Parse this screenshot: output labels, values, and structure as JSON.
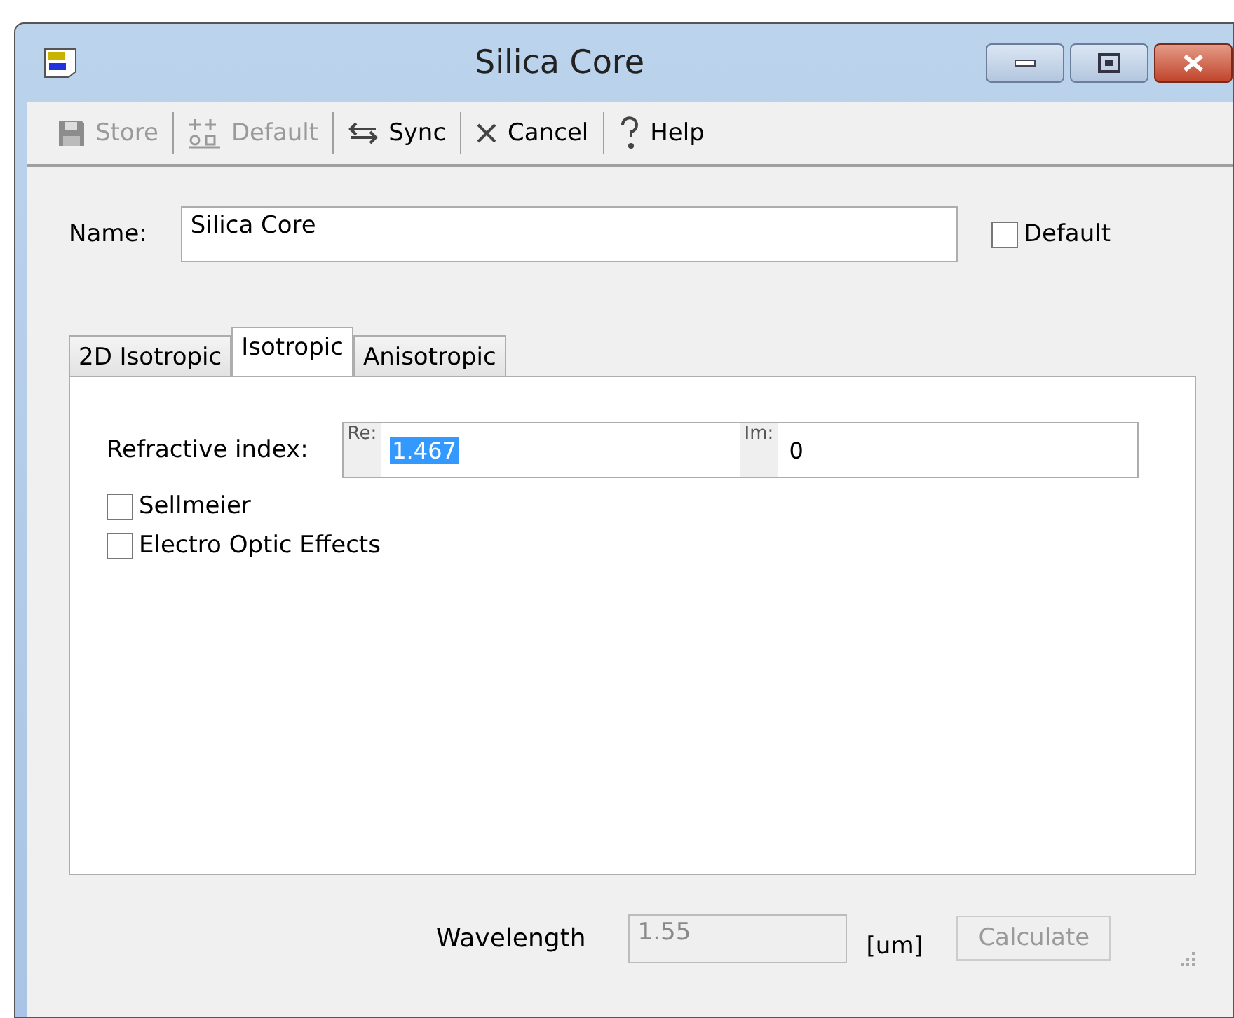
{
  "window": {
    "title": "Silica Core"
  },
  "toolbar": [
    {
      "kind": "store",
      "label": "Store",
      "disabled": true
    },
    {
      "kind": "default",
      "label": "Default",
      "disabled": true
    },
    {
      "kind": "sync",
      "label": "Sync",
      "disabled": false
    },
    {
      "kind": "cancel",
      "label": "Cancel",
      "disabled": false
    },
    {
      "kind": "help",
      "label": "Help",
      "disabled": false
    }
  ],
  "name": {
    "label": "Name:",
    "value": "Silica Core"
  },
  "default_checkbox": {
    "label": "Default",
    "checked": false
  },
  "tabs": [
    {
      "label": "2D Isotropic",
      "selected": false
    },
    {
      "label": "Isotropic",
      "selected": true
    },
    {
      "label": "Anisotropic",
      "selected": false
    }
  ],
  "refractive_index": {
    "label": "Refractive index:",
    "re_label": "Re:",
    "re_value": "1.467",
    "re_value_selected": true,
    "im_label": "Im:",
    "im_value": "0"
  },
  "options": [
    {
      "label": "Sellmeier",
      "checked": false
    },
    {
      "label": "Electro Optic Effects",
      "checked": false
    }
  ],
  "wavelength": {
    "label": "Wavelength",
    "value": "1.55",
    "disabled": true,
    "unit": "[um]"
  },
  "calculate_button": {
    "label": "Calculate",
    "disabled": true
  }
}
